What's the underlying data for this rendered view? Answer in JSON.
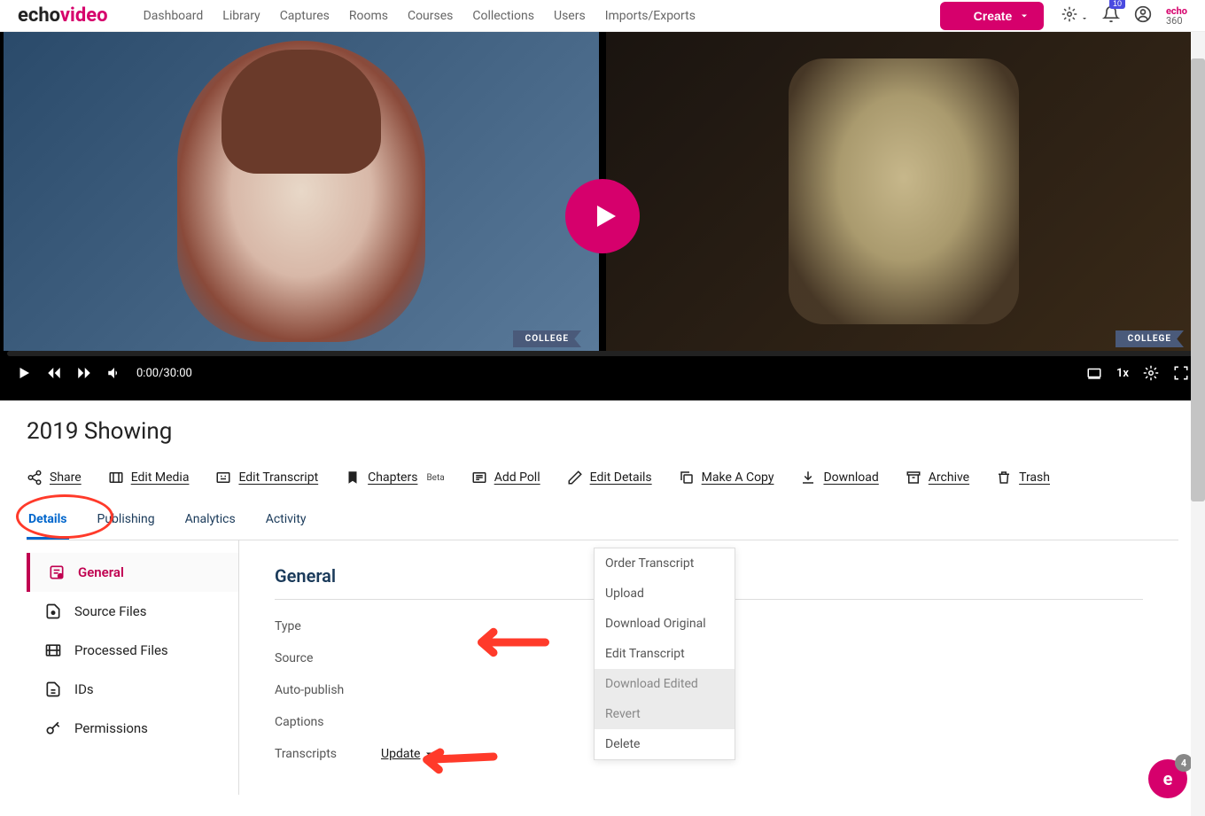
{
  "nav": {
    "logo_a": "echo",
    "logo_b": "video",
    "links": [
      "Dashboard",
      "Library",
      "Captures",
      "Rooms",
      "Courses",
      "Collections",
      "Users",
      "Imports/Exports"
    ],
    "create": "Create",
    "notif_count": "10",
    "brand_small_a": "echo",
    "brand_small_b": "360"
  },
  "player": {
    "time": "0:00/30:00",
    "speed": "1x",
    "college": "COLLEGE"
  },
  "page": {
    "title": "2019 Showing"
  },
  "actions": {
    "share": "Share",
    "edit_media": "Edit Media",
    "edit_transcript": "Edit Transcript",
    "chapters": "Chapters",
    "chapters_beta": "Beta",
    "add_poll": "Add Poll",
    "edit_details": "Edit Details",
    "make_copy": "Make A Copy",
    "download": "Download",
    "archive": "Archive",
    "trash": "Trash"
  },
  "tabs": {
    "details": "Details",
    "publishing": "Publishing",
    "analytics": "Analytics",
    "activity": "Activity"
  },
  "sidebar": {
    "items": [
      {
        "label": "General"
      },
      {
        "label": "Source Files"
      },
      {
        "label": "Processed Files"
      },
      {
        "label": "IDs"
      },
      {
        "label": "Permissions"
      }
    ]
  },
  "general": {
    "heading": "General",
    "fields": {
      "type": "Type",
      "source": "Source",
      "auto_publish": "Auto-publish",
      "captions": "Captions",
      "transcripts": "Transcripts"
    },
    "update": "Update"
  },
  "dropdown": {
    "items": [
      {
        "label": "Order Transcript",
        "disabled": false
      },
      {
        "label": "Upload",
        "disabled": false
      },
      {
        "label": "Download Original",
        "disabled": false
      },
      {
        "label": "Edit Transcript",
        "disabled": false
      },
      {
        "label": "Download Edited",
        "disabled": true
      },
      {
        "label": "Revert",
        "disabled": true
      },
      {
        "label": "Delete",
        "disabled": false
      }
    ]
  },
  "fab": {
    "letter": "e",
    "count": "4"
  }
}
